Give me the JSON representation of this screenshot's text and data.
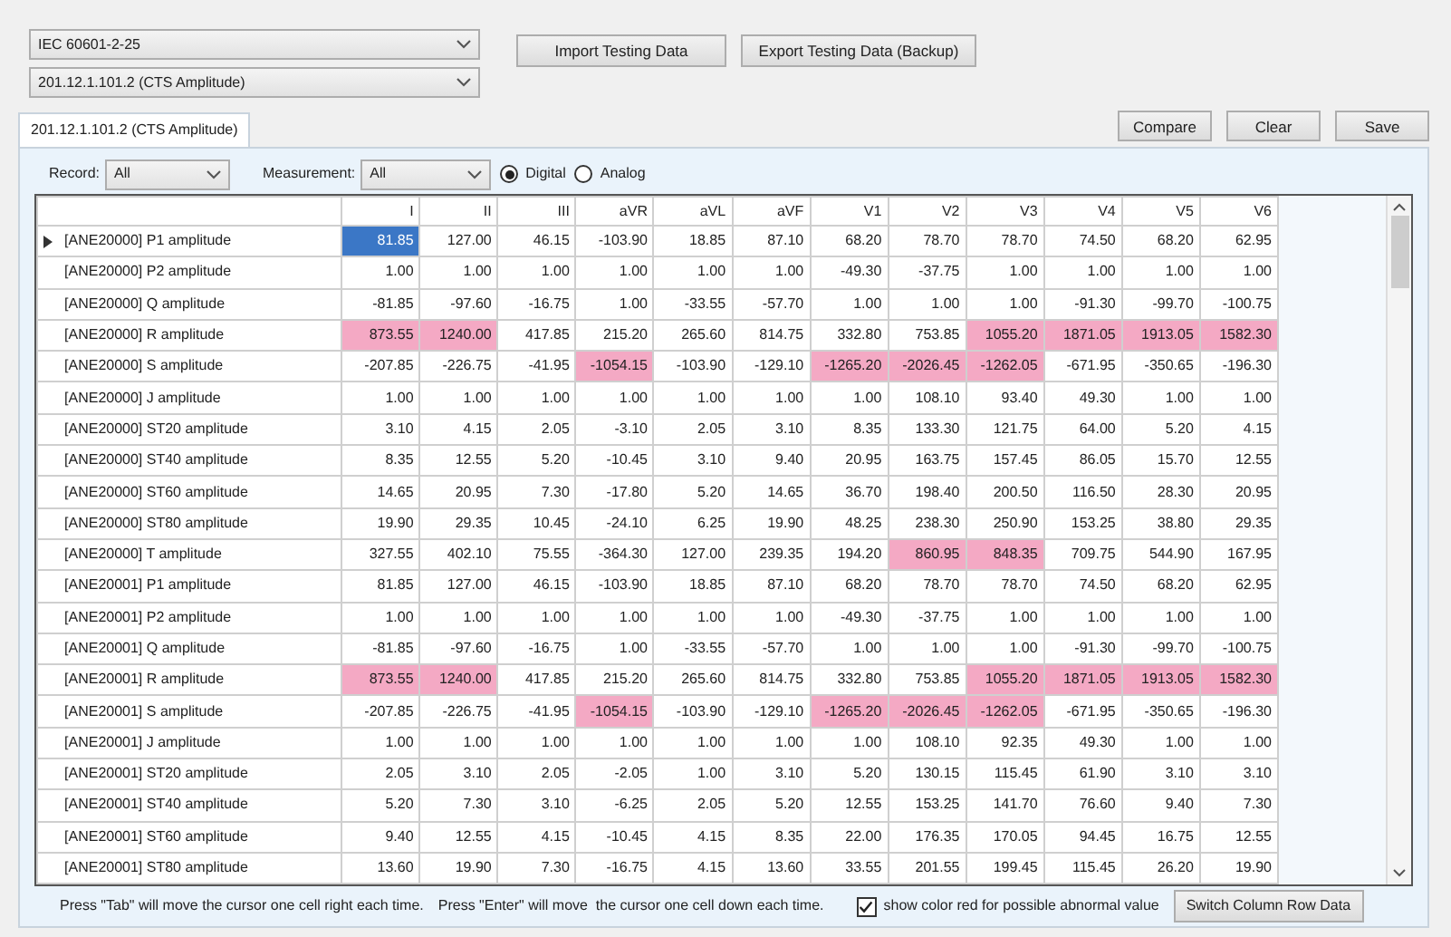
{
  "standard_select": {
    "value": "IEC 60601-2-25"
  },
  "clause_select": {
    "value": "201.12.1.101.2 (CTS Amplitude)"
  },
  "top_buttons": [
    "Import Testing Data",
    "Export Testing Data (Backup)"
  ],
  "tabs": [
    {
      "label": "201.12.1.101.2 (CTS Amplitude)",
      "selected": true
    }
  ],
  "action_buttons": [
    "Compare",
    "Clear",
    "Save"
  ],
  "filters": {
    "record_label": "Record:",
    "record_value": "All",
    "measurement_label": "Measurement:",
    "measurement_value": "All"
  },
  "mode_options": [
    {
      "label": "Digital",
      "selected": true
    },
    {
      "label": "Analog",
      "selected": false
    }
  ],
  "table": {
    "columns": [
      "I",
      "II",
      "III",
      "aVR",
      "aVL",
      "aVF",
      "V1",
      "V2",
      "V3",
      "V4",
      "V5",
      "V6"
    ],
    "rows": [
      {
        "label": "[ANE20000] P1 amplitude",
        "selected": true,
        "cells": [
          {
            "value": "81.85",
            "abnormal": false,
            "selected": true
          },
          {
            "value": "127.00",
            "abnormal": false,
            "selected": false
          },
          {
            "value": "46.15",
            "abnormal": false,
            "selected": false
          },
          {
            "value": "-103.90",
            "abnormal": false,
            "selected": false
          },
          {
            "value": "18.85",
            "abnormal": false,
            "selected": false
          },
          {
            "value": "87.10",
            "abnormal": false,
            "selected": false
          },
          {
            "value": "68.20",
            "abnormal": false,
            "selected": false
          },
          {
            "value": "78.70",
            "abnormal": false,
            "selected": false
          },
          {
            "value": "78.70",
            "abnormal": false,
            "selected": false
          },
          {
            "value": "74.50",
            "abnormal": false,
            "selected": false
          },
          {
            "value": "68.20",
            "abnormal": false,
            "selected": false
          },
          {
            "value": "62.95",
            "abnormal": false,
            "selected": false
          }
        ]
      },
      {
        "label": "[ANE20000] P2 amplitude",
        "selected": false,
        "cells": [
          {
            "value": "1.00",
            "abnormal": false,
            "selected": false
          },
          {
            "value": "1.00",
            "abnormal": false,
            "selected": false
          },
          {
            "value": "1.00",
            "abnormal": false,
            "selected": false
          },
          {
            "value": "1.00",
            "abnormal": false,
            "selected": false
          },
          {
            "value": "1.00",
            "abnormal": false,
            "selected": false
          },
          {
            "value": "1.00",
            "abnormal": false,
            "selected": false
          },
          {
            "value": "-49.30",
            "abnormal": false,
            "selected": false
          },
          {
            "value": "-37.75",
            "abnormal": false,
            "selected": false
          },
          {
            "value": "1.00",
            "abnormal": false,
            "selected": false
          },
          {
            "value": "1.00",
            "abnormal": false,
            "selected": false
          },
          {
            "value": "1.00",
            "abnormal": false,
            "selected": false
          },
          {
            "value": "1.00",
            "abnormal": false,
            "selected": false
          }
        ]
      },
      {
        "label": "[ANE20000] Q amplitude",
        "selected": false,
        "cells": [
          {
            "value": "-81.85",
            "abnormal": false,
            "selected": false
          },
          {
            "value": "-97.60",
            "abnormal": false,
            "selected": false
          },
          {
            "value": "-16.75",
            "abnormal": false,
            "selected": false
          },
          {
            "value": "1.00",
            "abnormal": false,
            "selected": false
          },
          {
            "value": "-33.55",
            "abnormal": false,
            "selected": false
          },
          {
            "value": "-57.70",
            "abnormal": false,
            "selected": false
          },
          {
            "value": "1.00",
            "abnormal": false,
            "selected": false
          },
          {
            "value": "1.00",
            "abnormal": false,
            "selected": false
          },
          {
            "value": "1.00",
            "abnormal": false,
            "selected": false
          },
          {
            "value": "-91.30",
            "abnormal": false,
            "selected": false
          },
          {
            "value": "-99.70",
            "abnormal": false,
            "selected": false
          },
          {
            "value": "-100.75",
            "abnormal": false,
            "selected": false
          }
        ]
      },
      {
        "label": "[ANE20000] R amplitude",
        "selected": false,
        "cells": [
          {
            "value": "873.55",
            "abnormal": true,
            "selected": false
          },
          {
            "value": "1240.00",
            "abnormal": true,
            "selected": false
          },
          {
            "value": "417.85",
            "abnormal": false,
            "selected": false
          },
          {
            "value": "215.20",
            "abnormal": false,
            "selected": false
          },
          {
            "value": "265.60",
            "abnormal": false,
            "selected": false
          },
          {
            "value": "814.75",
            "abnormal": false,
            "selected": false
          },
          {
            "value": "332.80",
            "abnormal": false,
            "selected": false
          },
          {
            "value": "753.85",
            "abnormal": false,
            "selected": false
          },
          {
            "value": "1055.20",
            "abnormal": true,
            "selected": false
          },
          {
            "value": "1871.05",
            "abnormal": true,
            "selected": false
          },
          {
            "value": "1913.05",
            "abnormal": true,
            "selected": false
          },
          {
            "value": "1582.30",
            "abnormal": true,
            "selected": false
          }
        ]
      },
      {
        "label": "[ANE20000] S amplitude",
        "selected": false,
        "cells": [
          {
            "value": "-207.85",
            "abnormal": false,
            "selected": false
          },
          {
            "value": "-226.75",
            "abnormal": false,
            "selected": false
          },
          {
            "value": "-41.95",
            "abnormal": false,
            "selected": false
          },
          {
            "value": "-1054.15",
            "abnormal": true,
            "selected": false
          },
          {
            "value": "-103.90",
            "abnormal": false,
            "selected": false
          },
          {
            "value": "-129.10",
            "abnormal": false,
            "selected": false
          },
          {
            "value": "-1265.20",
            "abnormal": true,
            "selected": false
          },
          {
            "value": "-2026.45",
            "abnormal": true,
            "selected": false
          },
          {
            "value": "-1262.05",
            "abnormal": true,
            "selected": false
          },
          {
            "value": "-671.95",
            "abnormal": false,
            "selected": false
          },
          {
            "value": "-350.65",
            "abnormal": false,
            "selected": false
          },
          {
            "value": "-196.30",
            "abnormal": false,
            "selected": false
          }
        ]
      },
      {
        "label": "[ANE20000] J amplitude",
        "selected": false,
        "cells": [
          {
            "value": "1.00",
            "abnormal": false,
            "selected": false
          },
          {
            "value": "1.00",
            "abnormal": false,
            "selected": false
          },
          {
            "value": "1.00",
            "abnormal": false,
            "selected": false
          },
          {
            "value": "1.00",
            "abnormal": false,
            "selected": false
          },
          {
            "value": "1.00",
            "abnormal": false,
            "selected": false
          },
          {
            "value": "1.00",
            "abnormal": false,
            "selected": false
          },
          {
            "value": "1.00",
            "abnormal": false,
            "selected": false
          },
          {
            "value": "108.10",
            "abnormal": false,
            "selected": false
          },
          {
            "value": "93.40",
            "abnormal": false,
            "selected": false
          },
          {
            "value": "49.30",
            "abnormal": false,
            "selected": false
          },
          {
            "value": "1.00",
            "abnormal": false,
            "selected": false
          },
          {
            "value": "1.00",
            "abnormal": false,
            "selected": false
          }
        ]
      },
      {
        "label": "[ANE20000] ST20 amplitude",
        "selected": false,
        "cells": [
          {
            "value": "3.10",
            "abnormal": false,
            "selected": false
          },
          {
            "value": "4.15",
            "abnormal": false,
            "selected": false
          },
          {
            "value": "2.05",
            "abnormal": false,
            "selected": false
          },
          {
            "value": "-3.10",
            "abnormal": false,
            "selected": false
          },
          {
            "value": "2.05",
            "abnormal": false,
            "selected": false
          },
          {
            "value": "3.10",
            "abnormal": false,
            "selected": false
          },
          {
            "value": "8.35",
            "abnormal": false,
            "selected": false
          },
          {
            "value": "133.30",
            "abnormal": false,
            "selected": false
          },
          {
            "value": "121.75",
            "abnormal": false,
            "selected": false
          },
          {
            "value": "64.00",
            "abnormal": false,
            "selected": false
          },
          {
            "value": "5.20",
            "abnormal": false,
            "selected": false
          },
          {
            "value": "4.15",
            "abnormal": false,
            "selected": false
          }
        ]
      },
      {
        "label": "[ANE20000] ST40 amplitude",
        "selected": false,
        "cells": [
          {
            "value": "8.35",
            "abnormal": false,
            "selected": false
          },
          {
            "value": "12.55",
            "abnormal": false,
            "selected": false
          },
          {
            "value": "5.20",
            "abnormal": false,
            "selected": false
          },
          {
            "value": "-10.45",
            "abnormal": false,
            "selected": false
          },
          {
            "value": "3.10",
            "abnormal": false,
            "selected": false
          },
          {
            "value": "9.40",
            "abnormal": false,
            "selected": false
          },
          {
            "value": "20.95",
            "abnormal": false,
            "selected": false
          },
          {
            "value": "163.75",
            "abnormal": false,
            "selected": false
          },
          {
            "value": "157.45",
            "abnormal": false,
            "selected": false
          },
          {
            "value": "86.05",
            "abnormal": false,
            "selected": false
          },
          {
            "value": "15.70",
            "abnormal": false,
            "selected": false
          },
          {
            "value": "12.55",
            "abnormal": false,
            "selected": false
          }
        ]
      },
      {
        "label": "[ANE20000] ST60 amplitude",
        "selected": false,
        "cells": [
          {
            "value": "14.65",
            "abnormal": false,
            "selected": false
          },
          {
            "value": "20.95",
            "abnormal": false,
            "selected": false
          },
          {
            "value": "7.30",
            "abnormal": false,
            "selected": false
          },
          {
            "value": "-17.80",
            "abnormal": false,
            "selected": false
          },
          {
            "value": "5.20",
            "abnormal": false,
            "selected": false
          },
          {
            "value": "14.65",
            "abnormal": false,
            "selected": false
          },
          {
            "value": "36.70",
            "abnormal": false,
            "selected": false
          },
          {
            "value": "198.40",
            "abnormal": false,
            "selected": false
          },
          {
            "value": "200.50",
            "abnormal": false,
            "selected": false
          },
          {
            "value": "116.50",
            "abnormal": false,
            "selected": false
          },
          {
            "value": "28.30",
            "abnormal": false,
            "selected": false
          },
          {
            "value": "20.95",
            "abnormal": false,
            "selected": false
          }
        ]
      },
      {
        "label": "[ANE20000] ST80 amplitude",
        "selected": false,
        "cells": [
          {
            "value": "19.90",
            "abnormal": false,
            "selected": false
          },
          {
            "value": "29.35",
            "abnormal": false,
            "selected": false
          },
          {
            "value": "10.45",
            "abnormal": false,
            "selected": false
          },
          {
            "value": "-24.10",
            "abnormal": false,
            "selected": false
          },
          {
            "value": "6.25",
            "abnormal": false,
            "selected": false
          },
          {
            "value": "19.90",
            "abnormal": false,
            "selected": false
          },
          {
            "value": "48.25",
            "abnormal": false,
            "selected": false
          },
          {
            "value": "238.30",
            "abnormal": false,
            "selected": false
          },
          {
            "value": "250.90",
            "abnormal": false,
            "selected": false
          },
          {
            "value": "153.25",
            "abnormal": false,
            "selected": false
          },
          {
            "value": "38.80",
            "abnormal": false,
            "selected": false
          },
          {
            "value": "29.35",
            "abnormal": false,
            "selected": false
          }
        ]
      },
      {
        "label": "[ANE20000] T amplitude",
        "selected": false,
        "cells": [
          {
            "value": "327.55",
            "abnormal": false,
            "selected": false
          },
          {
            "value": "402.10",
            "abnormal": false,
            "selected": false
          },
          {
            "value": "75.55",
            "abnormal": false,
            "selected": false
          },
          {
            "value": "-364.30",
            "abnormal": false,
            "selected": false
          },
          {
            "value": "127.00",
            "abnormal": false,
            "selected": false
          },
          {
            "value": "239.35",
            "abnormal": false,
            "selected": false
          },
          {
            "value": "194.20",
            "abnormal": false,
            "selected": false
          },
          {
            "value": "860.95",
            "abnormal": true,
            "selected": false
          },
          {
            "value": "848.35",
            "abnormal": true,
            "selected": false
          },
          {
            "value": "709.75",
            "abnormal": false,
            "selected": false
          },
          {
            "value": "544.90",
            "abnormal": false,
            "selected": false
          },
          {
            "value": "167.95",
            "abnormal": false,
            "selected": false
          }
        ]
      },
      {
        "label": "[ANE20001] P1 amplitude",
        "selected": false,
        "cells": [
          {
            "value": "81.85",
            "abnormal": false,
            "selected": false
          },
          {
            "value": "127.00",
            "abnormal": false,
            "selected": false
          },
          {
            "value": "46.15",
            "abnormal": false,
            "selected": false
          },
          {
            "value": "-103.90",
            "abnormal": false,
            "selected": false
          },
          {
            "value": "18.85",
            "abnormal": false,
            "selected": false
          },
          {
            "value": "87.10",
            "abnormal": false,
            "selected": false
          },
          {
            "value": "68.20",
            "abnormal": false,
            "selected": false
          },
          {
            "value": "78.70",
            "abnormal": false,
            "selected": false
          },
          {
            "value": "78.70",
            "abnormal": false,
            "selected": false
          },
          {
            "value": "74.50",
            "abnormal": false,
            "selected": false
          },
          {
            "value": "68.20",
            "abnormal": false,
            "selected": false
          },
          {
            "value": "62.95",
            "abnormal": false,
            "selected": false
          }
        ]
      },
      {
        "label": "[ANE20001] P2 amplitude",
        "selected": false,
        "cells": [
          {
            "value": "1.00",
            "abnormal": false,
            "selected": false
          },
          {
            "value": "1.00",
            "abnormal": false,
            "selected": false
          },
          {
            "value": "1.00",
            "abnormal": false,
            "selected": false
          },
          {
            "value": "1.00",
            "abnormal": false,
            "selected": false
          },
          {
            "value": "1.00",
            "abnormal": false,
            "selected": false
          },
          {
            "value": "1.00",
            "abnormal": false,
            "selected": false
          },
          {
            "value": "-49.30",
            "abnormal": false,
            "selected": false
          },
          {
            "value": "-37.75",
            "abnormal": false,
            "selected": false
          },
          {
            "value": "1.00",
            "abnormal": false,
            "selected": false
          },
          {
            "value": "1.00",
            "abnormal": false,
            "selected": false
          },
          {
            "value": "1.00",
            "abnormal": false,
            "selected": false
          },
          {
            "value": "1.00",
            "abnormal": false,
            "selected": false
          }
        ]
      },
      {
        "label": "[ANE20001] Q amplitude",
        "selected": false,
        "cells": [
          {
            "value": "-81.85",
            "abnormal": false,
            "selected": false
          },
          {
            "value": "-97.60",
            "abnormal": false,
            "selected": false
          },
          {
            "value": "-16.75",
            "abnormal": false,
            "selected": false
          },
          {
            "value": "1.00",
            "abnormal": false,
            "selected": false
          },
          {
            "value": "-33.55",
            "abnormal": false,
            "selected": false
          },
          {
            "value": "-57.70",
            "abnormal": false,
            "selected": false
          },
          {
            "value": "1.00",
            "abnormal": false,
            "selected": false
          },
          {
            "value": "1.00",
            "abnormal": false,
            "selected": false
          },
          {
            "value": "1.00",
            "abnormal": false,
            "selected": false
          },
          {
            "value": "-91.30",
            "abnormal": false,
            "selected": false
          },
          {
            "value": "-99.70",
            "abnormal": false,
            "selected": false
          },
          {
            "value": "-100.75",
            "abnormal": false,
            "selected": false
          }
        ]
      },
      {
        "label": "[ANE20001] R amplitude",
        "selected": false,
        "cells": [
          {
            "value": "873.55",
            "abnormal": true,
            "selected": false
          },
          {
            "value": "1240.00",
            "abnormal": true,
            "selected": false
          },
          {
            "value": "417.85",
            "abnormal": false,
            "selected": false
          },
          {
            "value": "215.20",
            "abnormal": false,
            "selected": false
          },
          {
            "value": "265.60",
            "abnormal": false,
            "selected": false
          },
          {
            "value": "814.75",
            "abnormal": false,
            "selected": false
          },
          {
            "value": "332.80",
            "abnormal": false,
            "selected": false
          },
          {
            "value": "753.85",
            "abnormal": false,
            "selected": false
          },
          {
            "value": "1055.20",
            "abnormal": true,
            "selected": false
          },
          {
            "value": "1871.05",
            "abnormal": true,
            "selected": false
          },
          {
            "value": "1913.05",
            "abnormal": true,
            "selected": false
          },
          {
            "value": "1582.30",
            "abnormal": true,
            "selected": false
          }
        ]
      },
      {
        "label": "[ANE20001] S amplitude",
        "selected": false,
        "cells": [
          {
            "value": "-207.85",
            "abnormal": false,
            "selected": false
          },
          {
            "value": "-226.75",
            "abnormal": false,
            "selected": false
          },
          {
            "value": "-41.95",
            "abnormal": false,
            "selected": false
          },
          {
            "value": "-1054.15",
            "abnormal": true,
            "selected": false
          },
          {
            "value": "-103.90",
            "abnormal": false,
            "selected": false
          },
          {
            "value": "-129.10",
            "abnormal": false,
            "selected": false
          },
          {
            "value": "-1265.20",
            "abnormal": true,
            "selected": false
          },
          {
            "value": "-2026.45",
            "abnormal": true,
            "selected": false
          },
          {
            "value": "-1262.05",
            "abnormal": true,
            "selected": false
          },
          {
            "value": "-671.95",
            "abnormal": false,
            "selected": false
          },
          {
            "value": "-350.65",
            "abnormal": false,
            "selected": false
          },
          {
            "value": "-196.30",
            "abnormal": false,
            "selected": false
          }
        ]
      },
      {
        "label": "[ANE20001] J amplitude",
        "selected": false,
        "cells": [
          {
            "value": "1.00",
            "abnormal": false,
            "selected": false
          },
          {
            "value": "1.00",
            "abnormal": false,
            "selected": false
          },
          {
            "value": "1.00",
            "abnormal": false,
            "selected": false
          },
          {
            "value": "1.00",
            "abnormal": false,
            "selected": false
          },
          {
            "value": "1.00",
            "abnormal": false,
            "selected": false
          },
          {
            "value": "1.00",
            "abnormal": false,
            "selected": false
          },
          {
            "value": "1.00",
            "abnormal": false,
            "selected": false
          },
          {
            "value": "108.10",
            "abnormal": false,
            "selected": false
          },
          {
            "value": "92.35",
            "abnormal": false,
            "selected": false
          },
          {
            "value": "49.30",
            "abnormal": false,
            "selected": false
          },
          {
            "value": "1.00",
            "abnormal": false,
            "selected": false
          },
          {
            "value": "1.00",
            "abnormal": false,
            "selected": false
          }
        ]
      },
      {
        "label": "[ANE20001] ST20 amplitude",
        "selected": false,
        "cells": [
          {
            "value": "2.05",
            "abnormal": false,
            "selected": false
          },
          {
            "value": "3.10",
            "abnormal": false,
            "selected": false
          },
          {
            "value": "2.05",
            "abnormal": false,
            "selected": false
          },
          {
            "value": "-2.05",
            "abnormal": false,
            "selected": false
          },
          {
            "value": "1.00",
            "abnormal": false,
            "selected": false
          },
          {
            "value": "3.10",
            "abnormal": false,
            "selected": false
          },
          {
            "value": "5.20",
            "abnormal": false,
            "selected": false
          },
          {
            "value": "130.15",
            "abnormal": false,
            "selected": false
          },
          {
            "value": "115.45",
            "abnormal": false,
            "selected": false
          },
          {
            "value": "61.90",
            "abnormal": false,
            "selected": false
          },
          {
            "value": "3.10",
            "abnormal": false,
            "selected": false
          },
          {
            "value": "3.10",
            "abnormal": false,
            "selected": false
          }
        ]
      },
      {
        "label": "[ANE20001] ST40 amplitude",
        "selected": false,
        "cells": [
          {
            "value": "5.20",
            "abnormal": false,
            "selected": false
          },
          {
            "value": "7.30",
            "abnormal": false,
            "selected": false
          },
          {
            "value": "3.10",
            "abnormal": false,
            "selected": false
          },
          {
            "value": "-6.25",
            "abnormal": false,
            "selected": false
          },
          {
            "value": "2.05",
            "abnormal": false,
            "selected": false
          },
          {
            "value": "5.20",
            "abnormal": false,
            "selected": false
          },
          {
            "value": "12.55",
            "abnormal": false,
            "selected": false
          },
          {
            "value": "153.25",
            "abnormal": false,
            "selected": false
          },
          {
            "value": "141.70",
            "abnormal": false,
            "selected": false
          },
          {
            "value": "76.60",
            "abnormal": false,
            "selected": false
          },
          {
            "value": "9.40",
            "abnormal": false,
            "selected": false
          },
          {
            "value": "7.30",
            "abnormal": false,
            "selected": false
          }
        ]
      },
      {
        "label": "[ANE20001] ST60 amplitude",
        "selected": false,
        "cells": [
          {
            "value": "9.40",
            "abnormal": false,
            "selected": false
          },
          {
            "value": "12.55",
            "abnormal": false,
            "selected": false
          },
          {
            "value": "4.15",
            "abnormal": false,
            "selected": false
          },
          {
            "value": "-10.45",
            "abnormal": false,
            "selected": false
          },
          {
            "value": "4.15",
            "abnormal": false,
            "selected": false
          },
          {
            "value": "8.35",
            "abnormal": false,
            "selected": false
          },
          {
            "value": "22.00",
            "abnormal": false,
            "selected": false
          },
          {
            "value": "176.35",
            "abnormal": false,
            "selected": false
          },
          {
            "value": "170.05",
            "abnormal": false,
            "selected": false
          },
          {
            "value": "94.45",
            "abnormal": false,
            "selected": false
          },
          {
            "value": "16.75",
            "abnormal": false,
            "selected": false
          },
          {
            "value": "12.55",
            "abnormal": false,
            "selected": false
          }
        ]
      },
      {
        "label": "[ANE20001] ST80 amplitude",
        "selected": false,
        "cells": [
          {
            "value": "13.60",
            "abnormal": false,
            "selected": false
          },
          {
            "value": "19.90",
            "abnormal": false,
            "selected": false
          },
          {
            "value": "7.30",
            "abnormal": false,
            "selected": false
          },
          {
            "value": "-16.75",
            "abnormal": false,
            "selected": false
          },
          {
            "value": "4.15",
            "abnormal": false,
            "selected": false
          },
          {
            "value": "13.60",
            "abnormal": false,
            "selected": false
          },
          {
            "value": "33.55",
            "abnormal": false,
            "selected": false
          },
          {
            "value": "201.55",
            "abnormal": false,
            "selected": false
          },
          {
            "value": "199.45",
            "abnormal": false,
            "selected": false
          },
          {
            "value": "115.45",
            "abnormal": false,
            "selected": false
          },
          {
            "value": "26.20",
            "abnormal": false,
            "selected": false
          },
          {
            "value": "19.90",
            "abnormal": false,
            "selected": false
          }
        ]
      }
    ]
  },
  "footer": {
    "hints": [
      "Press \"Tab\" will move the cursor one cell right each time.",
      "Press \"Enter\" will move  the cursor one cell down each time."
    ],
    "show_red": {
      "label": "show color red for possible abnormal value",
      "checked": true
    },
    "switch_button": "Switch Column Row Data"
  }
}
